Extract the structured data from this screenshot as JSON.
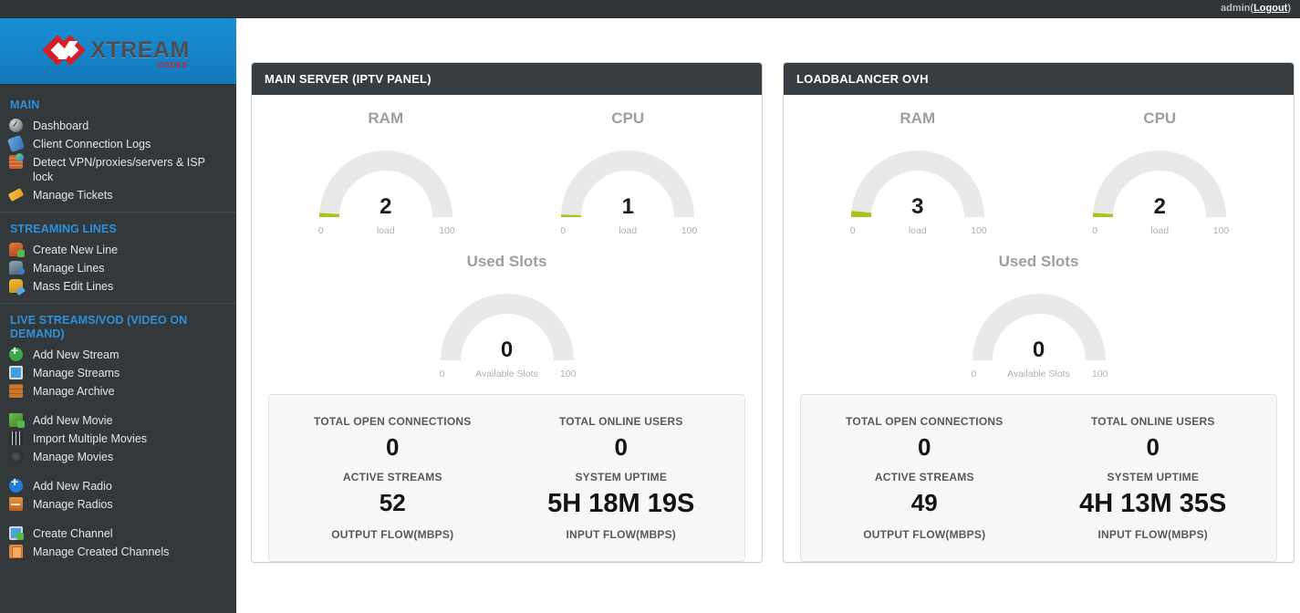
{
  "topbar": {
    "user": "admin",
    "open_paren": "(",
    "logout": "Logout",
    "close_paren": ")"
  },
  "brand": {
    "name": "XTREAM",
    "subtitle": "CODES"
  },
  "sidebar": {
    "sections": [
      {
        "title": "MAIN",
        "items": [
          {
            "label": "Dashboard",
            "icon": "dashboard-icon"
          },
          {
            "label": "Client Connection Logs",
            "icon": "plug-icon"
          },
          {
            "label": "Detect VPN/proxies/servers & ISP lock",
            "icon": "firewall-icon"
          },
          {
            "label": "Manage Tickets",
            "icon": "ticket-icon"
          }
        ]
      },
      {
        "title": "STREAMING LINES",
        "items": [
          {
            "label": "Create New Line",
            "icon": "user-add-icon"
          },
          {
            "label": "Manage Lines",
            "icon": "user-key-icon"
          },
          {
            "label": "Mass Edit Lines",
            "icon": "mass-edit-icon"
          }
        ]
      },
      {
        "title": "LIVE STREAMS/VOD (VIDEO ON DEMAND)",
        "items": [
          {
            "label": "Add New Stream",
            "icon": "plus-green-icon"
          },
          {
            "label": "Manage Streams",
            "icon": "tv-icon"
          },
          {
            "label": "Manage Archive",
            "icon": "archive-icon"
          },
          {
            "label": "Add New Movie",
            "icon": "movie-add-icon",
            "spaced": true
          },
          {
            "label": "Import Multiple Movies",
            "icon": "film-icon"
          },
          {
            "label": "Manage Movies",
            "icon": "reel-icon"
          },
          {
            "label": "Add New Radio",
            "icon": "plus-blue-icon",
            "spaced": true
          },
          {
            "label": "Manage Radios",
            "icon": "radio-icon"
          },
          {
            "label": "Create Channel",
            "icon": "tv-add-icon",
            "spaced": true
          },
          {
            "label": "Manage Created Channels",
            "icon": "copies-icon"
          }
        ]
      }
    ]
  },
  "colors": {
    "gauge_fill": "#a2c61c",
    "gauge_track": "#e9e9e9",
    "brand_blue": "#1683c6",
    "sidebar_bg": "#33383b",
    "panel_head": "#373d40"
  },
  "panels": [
    {
      "title": "MAIN SERVER (IPTV PANEL)",
      "gauges": [
        {
          "title": "RAM",
          "value": "2",
          "min": "0",
          "mid": "load",
          "max": "100",
          "percent": 2
        },
        {
          "title": "CPU",
          "value": "1",
          "min": "0",
          "mid": "load",
          "max": "100",
          "percent": 1
        }
      ],
      "slots": {
        "title": "Used Slots",
        "value": "0",
        "min": "0",
        "mid": "Available Slots",
        "max": "100",
        "percent": 0
      },
      "stats": [
        {
          "label": "TOTAL OPEN CONNECTIONS",
          "value": "0"
        },
        {
          "label": "TOTAL ONLINE USERS",
          "value": "0"
        },
        {
          "label": "ACTIVE STREAMS",
          "value": "52"
        },
        {
          "label": "SYSTEM UPTIME",
          "value": "5H 18M 19S"
        },
        {
          "label": "OUTPUT FLOW(MBPS)",
          "value": ""
        },
        {
          "label": "INPUT FLOW(MBPS)",
          "value": ""
        }
      ]
    },
    {
      "title": "LOADBALANCER OVH",
      "gauges": [
        {
          "title": "RAM",
          "value": "3",
          "min": "0",
          "mid": "load",
          "max": "100",
          "percent": 3
        },
        {
          "title": "CPU",
          "value": "2",
          "min": "0",
          "mid": "load",
          "max": "100",
          "percent": 2
        }
      ],
      "slots": {
        "title": "Used Slots",
        "value": "0",
        "min": "0",
        "mid": "Available Slots",
        "max": "100",
        "percent": 0
      },
      "stats": [
        {
          "label": "TOTAL OPEN CONNECTIONS",
          "value": "0"
        },
        {
          "label": "TOTAL ONLINE USERS",
          "value": "0"
        },
        {
          "label": "ACTIVE STREAMS",
          "value": "49"
        },
        {
          "label": "SYSTEM UPTIME",
          "value": "4H 13M 35S"
        },
        {
          "label": "OUTPUT FLOW(MBPS)",
          "value": ""
        },
        {
          "label": "INPUT FLOW(MBPS)",
          "value": ""
        }
      ]
    }
  ]
}
